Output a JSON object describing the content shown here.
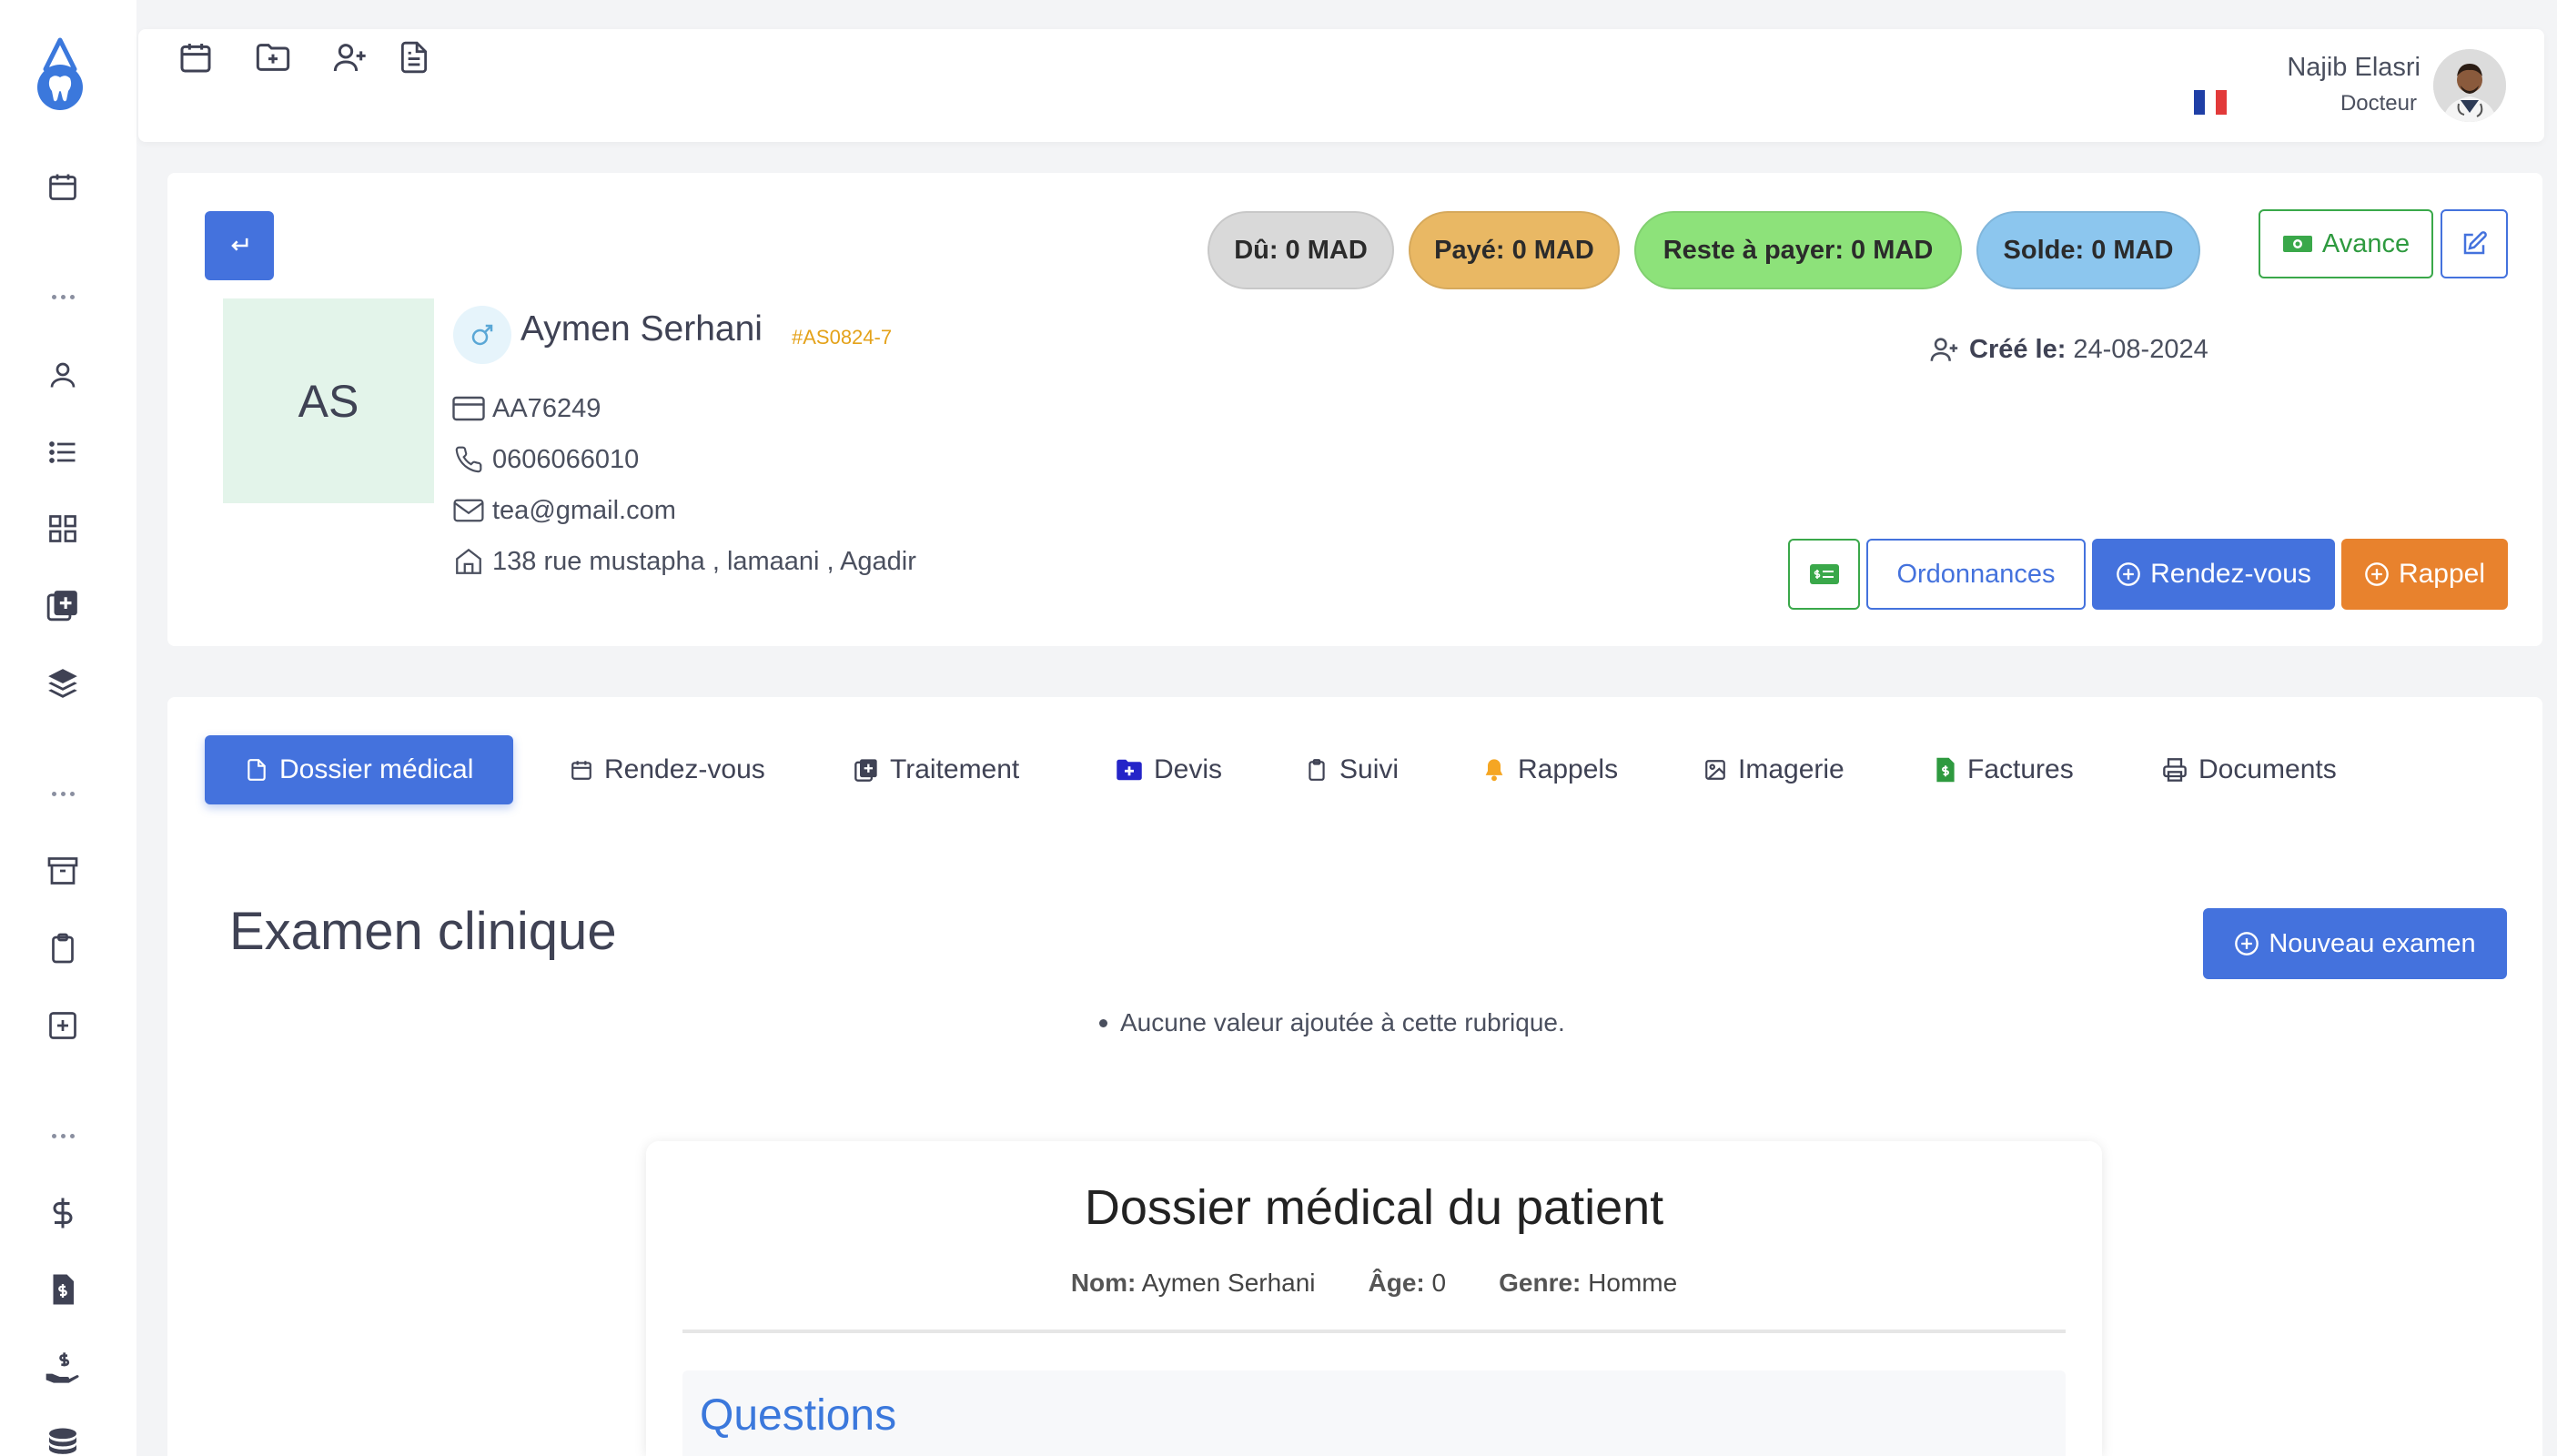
{
  "sidebar": {
    "logo_icon": "tooth-drop-logo",
    "items": [
      {
        "icon": "calendar-icon"
      },
      {
        "icon": "user-icon"
      },
      {
        "icon": "list-icon"
      },
      {
        "icon": "grid-icon"
      },
      {
        "icon": "medical-copy-icon"
      },
      {
        "icon": "layers-icon"
      },
      {
        "icon": "archive-icon"
      },
      {
        "icon": "clipboard-icon"
      },
      {
        "icon": "plus-square-icon"
      },
      {
        "icon": "dollar-icon"
      },
      {
        "icon": "invoice-icon"
      },
      {
        "icon": "hand-dollar-icon"
      },
      {
        "icon": "coins-icon"
      }
    ]
  },
  "topbar": {
    "icons": [
      "calendar-icon",
      "folder-plus-icon",
      "user-plus-icon",
      "document-icon"
    ],
    "user": {
      "name": "Najib Elasri",
      "role": "Docteur"
    },
    "language_flag": "france-flag"
  },
  "patient": {
    "initials": "AS",
    "name": "Aymen Serhani",
    "code": "#AS0824-7",
    "id_card": "AA76249",
    "phone": "0606066010",
    "email": "tea@gmail.com",
    "address": "138 rue mustapha , lamaani , Agadir",
    "created_label": "Créé le:",
    "created_date": "24-08-2024",
    "gender_icon": "male-icon"
  },
  "balances": {
    "du": "Dû: 0 MAD",
    "paye": "Payé: 0 MAD",
    "reste": "Reste à payer: 0 MAD",
    "solde": "Solde: 0 MAD"
  },
  "actions": {
    "avance": "Avance",
    "ordonnances": "Ordonnances",
    "rendez_vous": "Rendez-vous",
    "rappel": "Rappel"
  },
  "tabs": [
    {
      "label": "Dossier médical",
      "icon": "file-icon",
      "active": true
    },
    {
      "label": "Rendez-vous",
      "icon": "calendar-icon"
    },
    {
      "label": "Traitement",
      "icon": "medical-copy-icon"
    },
    {
      "label": "Devis",
      "icon": "folder-plus-icon"
    },
    {
      "label": "Suivi",
      "icon": "clipboard-icon"
    },
    {
      "label": "Rappels",
      "icon": "bell-icon"
    },
    {
      "label": "Imagerie",
      "icon": "image-icon"
    },
    {
      "label": "Factures",
      "icon": "invoice-icon"
    },
    {
      "label": "Documents",
      "icon": "printer-icon"
    }
  ],
  "exam": {
    "title": "Examen clinique",
    "new_button": "Nouveau examen",
    "empty": "Aucune valeur ajoutée à cette rubrique."
  },
  "record": {
    "title": "Dossier médical du patient",
    "nom_label": "Nom:",
    "nom": "Aymen Serhani",
    "age_label": "Âge:",
    "age": "0",
    "genre_label": "Genre:",
    "genre": "Homme",
    "questions": "Questions"
  },
  "colors": {
    "primary": "#4472dd",
    "orange": "#e8822d",
    "green": "#3aa84a",
    "pill_du": "#d9d9d9",
    "pill_paye": "#e9b864",
    "pill_reste": "#8de27a",
    "pill_solde": "#8cc6ee"
  }
}
